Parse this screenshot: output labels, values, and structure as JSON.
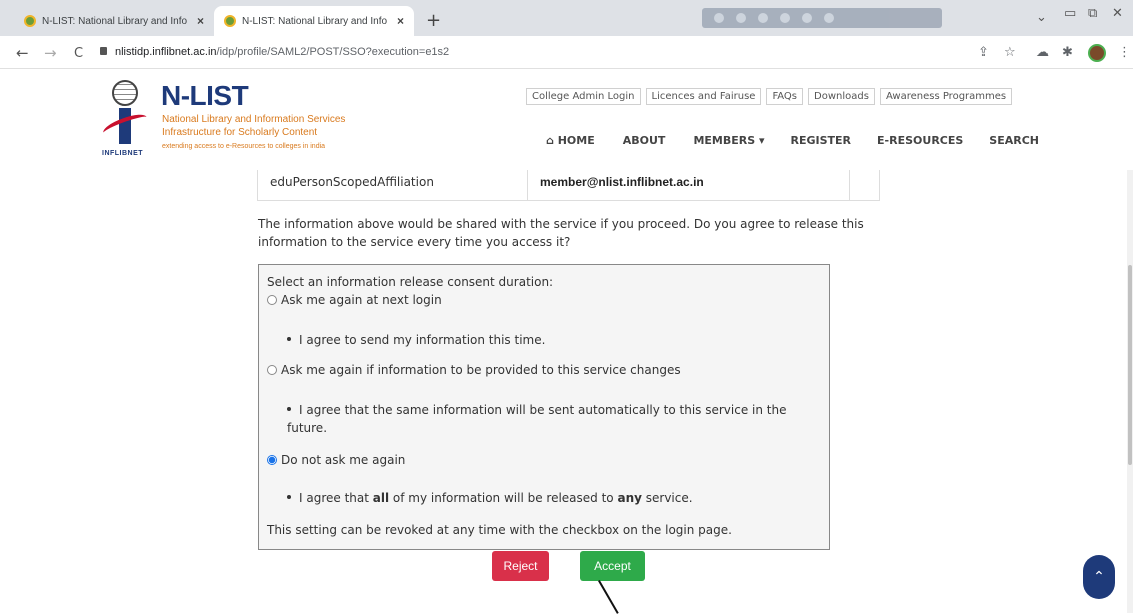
{
  "browser": {
    "tabs": [
      {
        "title": "N-LIST: National Library and Info",
        "close": "×"
      },
      {
        "title": "N-LIST: National Library and Info",
        "close": "×"
      }
    ],
    "new_tab": "+",
    "window_controls": {
      "minimize": "▭",
      "restore": "⧉",
      "close": "✕",
      "chevron": "⌄"
    },
    "nav": {
      "back": "←",
      "forward": "→",
      "reload": "C"
    },
    "url_host": "nlistidp.inflibnet.ac.in",
    "url_path": "/idp/profile/SAML2/POST/SSO?execution=e1s2",
    "toolbar_icons": {
      "share": "⇪",
      "star": "☆",
      "cloud": "☁",
      "puzzle": "✱",
      "menu": "⋮"
    }
  },
  "site": {
    "brand_mark": "INFLIBNET",
    "title": "N-LIST",
    "subtitle1": "National Library and Information Services",
    "subtitle2": "Infrastructure for Scholarly Content",
    "tagline": "extending access to e-Resources to colleges in india",
    "top_links": [
      "College Admin Login",
      "Licences and Fairuse",
      "FAQs",
      "Downloads",
      "Awareness Programmes"
    ],
    "nav": {
      "home_icon": "⌂",
      "home": "HOME",
      "about": "ABOUT",
      "members": "MEMBERS",
      "members_caret": "▾",
      "register": "REGISTER",
      "eresources": "E-RESOURCES",
      "search": "SEARCH"
    }
  },
  "attribute": {
    "name": "eduPersonScopedAffiliation",
    "value": "member@nlist.inflibnet.ac.in"
  },
  "consent": {
    "intro": "The information above would be shared with the service if you proceed. Do you agree to release this information to the service every time you access it?",
    "prompt": "Select an information release consent duration:",
    "options": [
      {
        "label": "Ask me again at next login",
        "selected": false,
        "detail": "I agree to send my information this time."
      },
      {
        "label": "Ask me again if information to be provided to this service changes",
        "selected": false,
        "detail": "I agree that the same information will be sent automatically to this service in the future."
      },
      {
        "label": "Do not ask me again",
        "selected": true,
        "detail_pre": "I agree that ",
        "detail_bold1": "all",
        "detail_mid": " of my information will be released to ",
        "detail_bold2": "any",
        "detail_post": " service."
      }
    ],
    "footer": "This setting can be revoked at any time with the checkbox on the login page.",
    "reject_label": "Reject",
    "accept_label": "Accept"
  },
  "scroll_top_icon": "⌃"
}
